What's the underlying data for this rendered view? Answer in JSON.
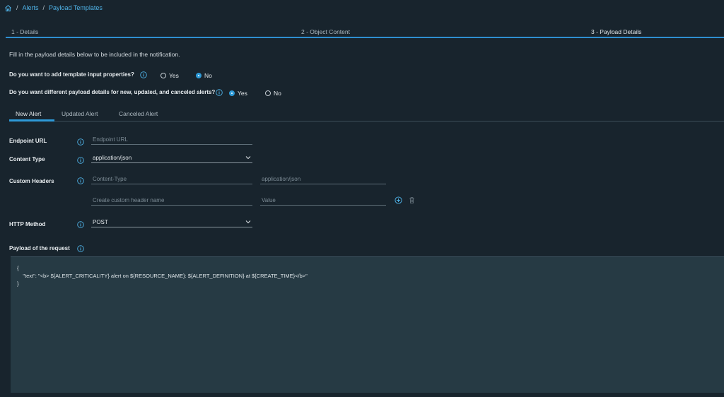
{
  "breadcrumb": {
    "home_icon": "home-icon",
    "separator": "/",
    "items": [
      "Alerts",
      "Payload Templates"
    ]
  },
  "steps": [
    {
      "label": "1 - Details"
    },
    {
      "label": "2 - Object Content"
    },
    {
      "label": "3 - Payload Details"
    }
  ],
  "intro_text": "Fill in the payload details below to be included in the notification.",
  "questions": {
    "template_input": {
      "label": "Do you want to add template input properties?",
      "options": [
        "Yes",
        "No"
      ],
      "selected": "No"
    },
    "different_payload": {
      "label": "Do you want different payload details for new, updated, and canceled alerts?",
      "options": [
        "Yes",
        "No"
      ],
      "selected": "Yes"
    }
  },
  "tabs": [
    "New Alert",
    "Updated Alert",
    "Canceled Alert"
  ],
  "active_tab": "New Alert",
  "form": {
    "endpoint_url": {
      "label": "Endpoint URL",
      "placeholder": "Endpoint URL",
      "value": ""
    },
    "content_type": {
      "label": "Content Type",
      "value": "application/json"
    },
    "custom_headers": {
      "label": "Custom Headers",
      "rows": [
        {
          "name_placeholder": "Content-Type",
          "value_placeholder": "application/json"
        },
        {
          "name_placeholder": "Create custom header name",
          "value_placeholder": "Value"
        }
      ]
    },
    "http_method": {
      "label": "HTTP Method",
      "value": "POST"
    },
    "payload": {
      "label": "Payload of the request",
      "text": "{\n    \"text\": \"<b> ${ALERT_CRITICALITY} alert on ${RESOURCE_NAME}: ${ALERT_DEFINITION} at ${CREATE_TIME}</b>\"\n}"
    }
  },
  "colors": {
    "background": "#18242d",
    "accent": "#2e9ad7",
    "link": "#4fb3e8",
    "payload_bg": "#263a44"
  }
}
